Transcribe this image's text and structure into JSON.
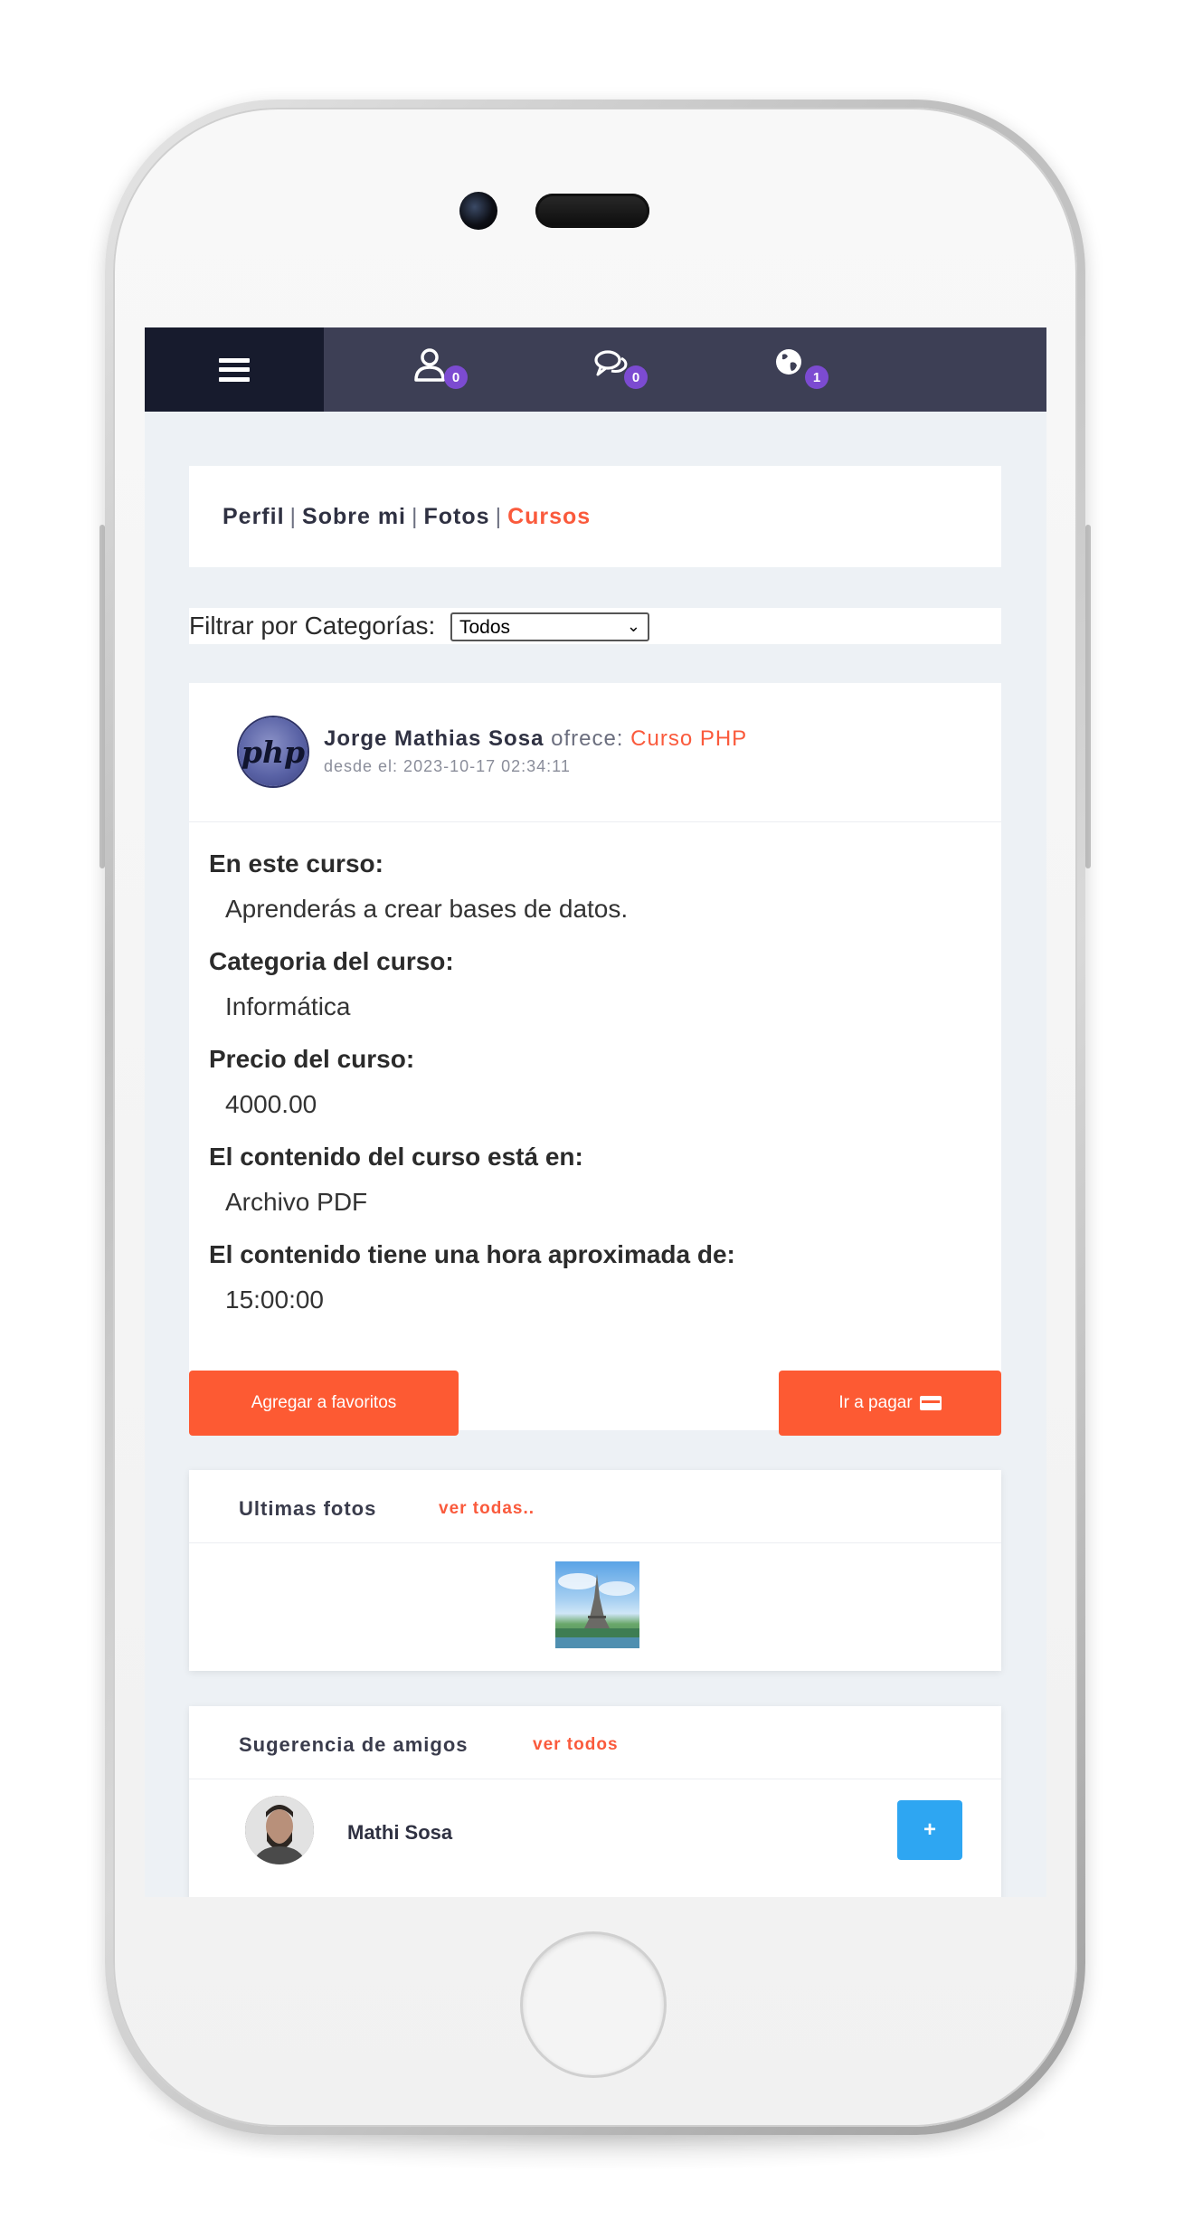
{
  "topbar": {
    "badges": {
      "profile": "0",
      "messages": "0",
      "notifications": "1"
    }
  },
  "tabs": [
    {
      "label": "Perfil"
    },
    {
      "label": "Sobre mi"
    },
    {
      "label": "Fotos"
    },
    {
      "label": "Cursos"
    }
  ],
  "filter": {
    "label": "Filtrar por Categorías:",
    "selected": "Todos"
  },
  "course": {
    "author": "Jorge Mathias Sosa",
    "offers_word": "ofrece:",
    "course_name": "Curso PHP",
    "date_line": "desde el: 2023-10-17 02:34:11",
    "avatar_text": "php",
    "details": [
      {
        "label": "En este curso:",
        "value": "Aprenderás a crear bases de datos."
      },
      {
        "label": "Categoria del curso:",
        "value": "Informática"
      },
      {
        "label": "Precio del curso:",
        "value": "4000.00"
      },
      {
        "label": "El contenido del curso está en:",
        "value": "Archivo PDF"
      },
      {
        "label": "El contenido tiene una hora aproximada de:",
        "value": "15:00:00"
      }
    ],
    "fav_label": "Agregar a favoritos",
    "pay_label": "Ir a pagar"
  },
  "photos": {
    "title": "Ultimas fotos",
    "link": "ver todas.."
  },
  "friends": {
    "title": "Sugerencia de amigos",
    "link": "ver todos",
    "items": [
      {
        "name": "Mathi Sosa",
        "add_label": "+"
      }
    ]
  },
  "colors": {
    "accent": "#fa5a3c",
    "button_orange": "#fd5a33",
    "topbar": "#3d3f55",
    "menu_dark": "#171b2d",
    "badge": "#7c4bd1",
    "add_blue": "#2ea6f2"
  }
}
